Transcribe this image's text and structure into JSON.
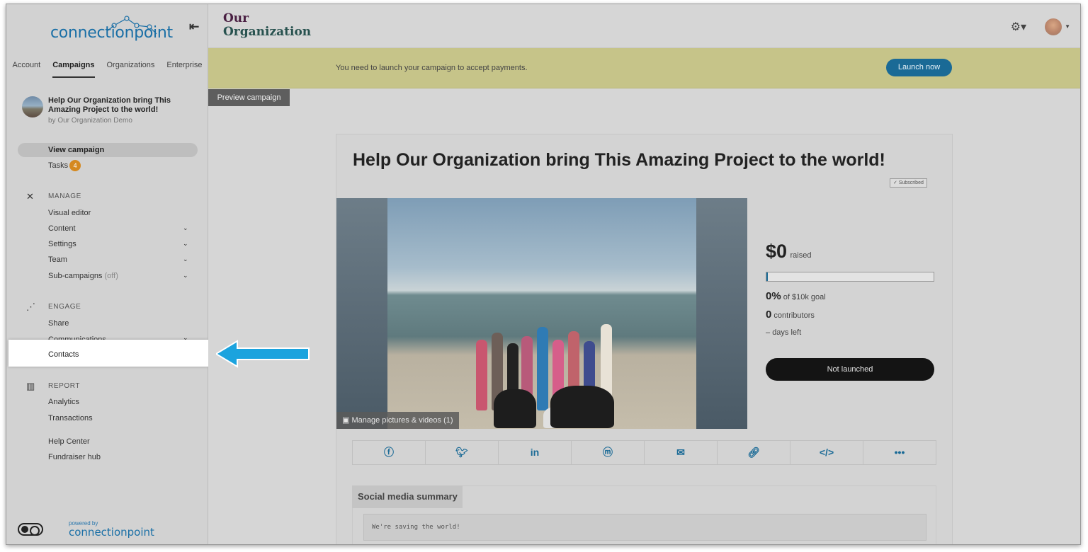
{
  "brand": {
    "logo_text": "connectionpoint",
    "powered_by": "powered by",
    "powered_logo": "connectionpoint"
  },
  "sidebar": {
    "tabs": [
      "Account",
      "Campaigns",
      "Organizations",
      "Enterprise"
    ],
    "active_tab": "Campaigns",
    "campaign": {
      "title": "Help Our Organization bring This Amazing Project to the world!",
      "by": "by Our Organization Demo"
    },
    "view_campaign": "View campaign",
    "tasks": {
      "label": "Tasks",
      "count": "4"
    },
    "manage": {
      "heading": "MANAGE",
      "items": [
        "Visual editor",
        "Content",
        "Settings",
        "Team",
        "Sub-campaigns"
      ],
      "sub_campaigns_status": "(off)"
    },
    "engage": {
      "heading": "ENGAGE",
      "items": [
        "Share",
        "Communications",
        "Contacts"
      ]
    },
    "report": {
      "heading": "REPORT",
      "items": [
        "Analytics",
        "Transactions"
      ]
    },
    "extra": [
      "Help Center",
      "Fundraiser hub"
    ]
  },
  "header": {
    "org_line1": "Our",
    "org_line2": "Organization"
  },
  "banner": {
    "text": "You need to launch your campaign to accept payments.",
    "button": "Launch now"
  },
  "preview_button": "Preview campaign",
  "campaign_card": {
    "title": "Help Our Organization bring This Amazing Project to the world!",
    "subscribed": "Subscribed",
    "manage_media": "Manage pictures & videos (1)",
    "raised_amount": "$0",
    "raised_label": "raised",
    "progress_fraction": 0,
    "percent": "0%",
    "goal_text": "of $10k goal",
    "contributors_count": "0",
    "contributors_label": "contributors",
    "days_value": "–",
    "days_label": "days left",
    "status_button": "Not launched",
    "share_icons": [
      "facebook-icon",
      "twitter-icon",
      "linkedin-icon",
      "messenger-icon",
      "email-icon",
      "link-icon",
      "embed-icon",
      "more-icon"
    ],
    "social_summary_heading": "Social media summary",
    "social_summary_text": "We're saving the world!"
  },
  "colors": {
    "accent": "#1a6a96",
    "banner": "#c6c489",
    "callout_arrow": "#1ba3de",
    "badge": "#d5891f"
  }
}
